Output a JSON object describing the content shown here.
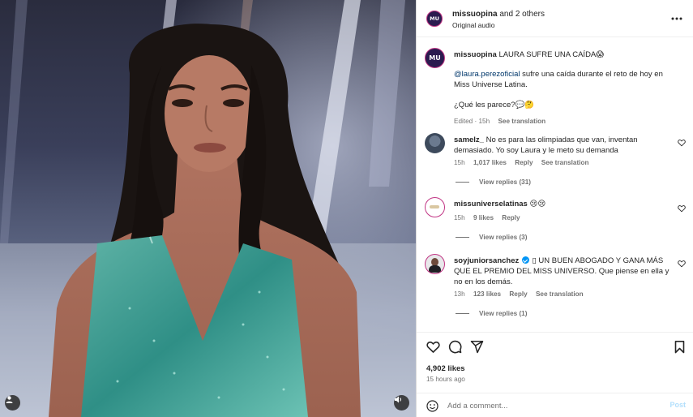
{
  "post": {
    "owner": "missuopina",
    "owner_suffix": "and 2 others",
    "audio": "Original audio",
    "avatar_text": "MU",
    "caption_user": "missuopina",
    "caption_text": "LAURA SUFRE UNA CAÍDA😱",
    "mention": "@laura.perezoficial",
    "caption_line2_rest": "sufre una caída durante el reto de hoy en",
    "caption_line3": "Miss Universe Latina.",
    "caption_question": "¿Qué les parece?💬🤔",
    "edited": "Edited · 15h",
    "see_translation": "See translation"
  },
  "comments": [
    {
      "user": "samelz_",
      "text": "No es para las olimpiadas que van, inventan demasiado. Yo soy Laura y le meto su demanda",
      "time": "15h",
      "likes": "1,017 likes",
      "reply": "Reply",
      "translation": "See translation",
      "view_replies": "View replies (31)"
    },
    {
      "user": "missuniverselatinas",
      "text": "😢😢",
      "time": "15h",
      "likes": "9 likes",
      "reply": "Reply",
      "view_replies": "View replies (3)"
    },
    {
      "user": "soyjuniorsanchez",
      "text": "▯ UN BUEN ABOGADO Y GANA MÁS QUE EL PREMIO DEL MISS UNIVERSO. Que piense en ella y no en los demás.",
      "time": "13h",
      "likes": "123 likes",
      "reply": "Reply",
      "translation": "See translation",
      "view_replies": "View replies (1)"
    }
  ],
  "footer": {
    "likes": "4,902 likes",
    "time": "15 hours ago",
    "comment_placeholder": "Add a comment...",
    "post_label": "Post"
  },
  "colors": {
    "link": "#00376b",
    "secondary": "#737373",
    "post_disabled": "#b2dffc",
    "verified": "#0095f6"
  }
}
